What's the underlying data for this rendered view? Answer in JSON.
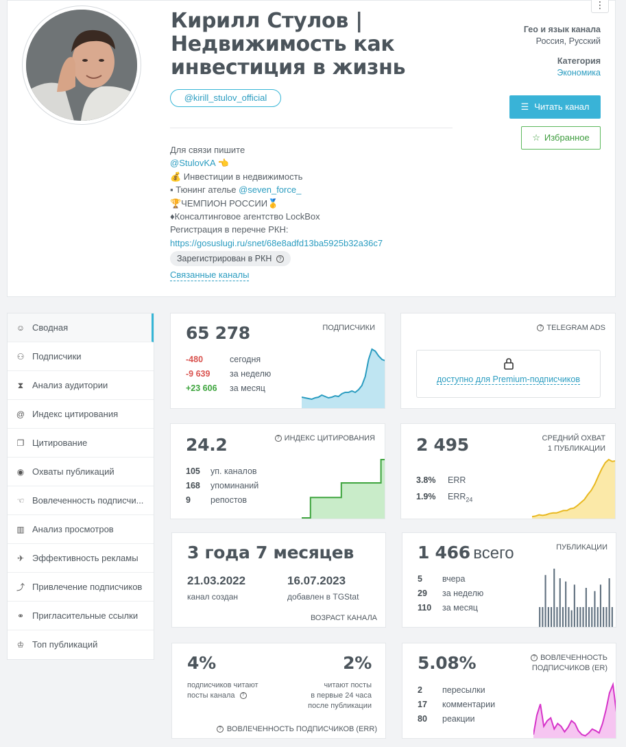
{
  "channel": {
    "title_lines": [
      "Кирилл Стулов |",
      "Недвижимость как",
      "инвестиция в жизнь"
    ],
    "handle": "@kirill_stulov_official",
    "description": [
      "Для связи пишите",
      "@StulovKA 👈",
      "💰 Инвестиции в недвижимость",
      "▪ Тюнинг ателье ",
      "🏆ЧЕМПИОН РОССИИ🥇",
      "♦Консалтинговое агентство LockBox",
      "Регистрация в перечне РКН:",
      "https://gosuslugi.ru/snet/68e8adfd13ba5925b32a36c7"
    ],
    "tuning_link": "@seven_force_",
    "rkn_badge": "Зарегистрирован в РКН",
    "related_link": "Связанные каналы",
    "geo_label": "Гео и язык канала",
    "geo_value": "Россия, Русский",
    "category_label": "Категория",
    "category_value": "Экономика",
    "read_button": "Читать канал",
    "favorite_button": "Избранное",
    "more_icon": "⋮"
  },
  "menu": [
    {
      "icon": "☺",
      "label": "Сводная",
      "active": true
    },
    {
      "icon": "⚇",
      "label": "Подписчики"
    },
    {
      "icon": "⧗",
      "label": "Анализ аудитории"
    },
    {
      "icon": "@",
      "label": "Индекс цитирования"
    },
    {
      "icon": "❐",
      "label": "Цитирование"
    },
    {
      "icon": "◉",
      "label": "Охваты публикаций"
    },
    {
      "icon": "☜",
      "label": "Вовлеченность подписчи..."
    },
    {
      "icon": "▥",
      "label": "Анализ просмотров"
    },
    {
      "icon": "✈",
      "label": "Эффективность рекламы"
    },
    {
      "icon": "⤴",
      "label": "Привлечение подписчиков"
    },
    {
      "icon": "⚭",
      "label": "Пригласительные ссылки"
    },
    {
      "icon": "♔",
      "label": "Топ публикаций"
    }
  ],
  "subscribers": {
    "value": "65 278",
    "label": "ПОДПИСЧИКИ",
    "rows": [
      {
        "v": "-480",
        "t": "сегодня"
      },
      {
        "v": "-9 639",
        "t": "за неделю"
      },
      {
        "v": "+23 606",
        "t": "за месяц"
      }
    ]
  },
  "ads": {
    "label": "TELEGRAM ADS",
    "locked_text": "доступно для Premium-подписчиков"
  },
  "citation": {
    "value": "24.2",
    "label": "ИНДЕКС ЦИТИРОВАНИЯ",
    "rows": [
      {
        "v": "105",
        "t": "уп. каналов"
      },
      {
        "v": "168",
        "t": "упоминаний"
      },
      {
        "v": "9",
        "t": "репостов"
      }
    ]
  },
  "reach": {
    "value": "2 495",
    "label_1": "СРЕДНИЙ ОХВАТ",
    "label_2": "1 ПУБЛИКАЦИИ",
    "rows": [
      {
        "v": "3.8%",
        "t": "ERR"
      },
      {
        "v": "1.9%",
        "t": "ERR",
        "sub": "24"
      }
    ]
  },
  "age": {
    "value": "3 года 7 месяцев",
    "created_date": "21.03.2022",
    "created_label": "канал создан",
    "added_date": "16.07.2023",
    "added_label": "добавлен в TGStat",
    "label": "ВОЗРАСТ КАНАЛА"
  },
  "posts": {
    "value": "1 466",
    "value_suffix": "всего",
    "label": "ПУБЛИКАЦИИ",
    "rows": [
      {
        "v": "5",
        "t": "вчера"
      },
      {
        "v": "29",
        "t": "за неделю"
      },
      {
        "v": "110",
        "t": "за месяц"
      }
    ]
  },
  "err": {
    "left_value": "4%",
    "left_text_1": "подписчиков читают",
    "left_text_2": "посты канала",
    "right_value": "2%",
    "right_text_1": "читают посты",
    "right_text_2": "в первые 24 часа",
    "right_text_3": "после публикации",
    "label": "ВОВЛЕЧЕННОСТЬ ПОДПИСЧИКОВ (ERR)"
  },
  "er": {
    "value": "5.08%",
    "label_1": "ВОВЛЕЧЕННОСТЬ",
    "label_2": "ПОДПИСЧИКОВ (ER)",
    "rows": [
      {
        "v": "2",
        "t": "пересылки"
      },
      {
        "v": "17",
        "t": "комментарии"
      },
      {
        "v": "80",
        "t": "реакции"
      }
    ]
  },
  "sparklines": {
    "subscribers": [
      15,
      14,
      13,
      12,
      14,
      15,
      18,
      16,
      14,
      15,
      17,
      16,
      20,
      22,
      22,
      24,
      22,
      26,
      32,
      45,
      70,
      85,
      82,
      75,
      70,
      68
    ],
    "citation": [
      0,
      0,
      35,
      35,
      35,
      35,
      35,
      35,
      35,
      60,
      60,
      60,
      60,
      60,
      60,
      60,
      60,
      60,
      100,
      100
    ],
    "reach": [
      2,
      3,
      5,
      4,
      5,
      7,
      8,
      8,
      10,
      12,
      12,
      15,
      16,
      20,
      25,
      30,
      38,
      45,
      55,
      68,
      80,
      90,
      95,
      92,
      93
    ],
    "posts": [
      30,
      30,
      80,
      30,
      30,
      90,
      30,
      75,
      30,
      70,
      30,
      25,
      65,
      30,
      30,
      30,
      60,
      30,
      30,
      55,
      30,
      65,
      30,
      30,
      75,
      30
    ],
    "er": [
      5,
      40,
      60,
      20,
      30,
      35,
      15,
      25,
      20,
      10,
      18,
      30,
      25,
      12,
      5,
      3,
      8,
      15,
      12,
      8,
      25,
      50,
      80,
      95,
      45
    ]
  },
  "colors": {
    "accent": "#35b5d6",
    "sub_line": "#2a9cc0",
    "sub_fill": "#bfe5f2",
    "cit_line": "#3da43d",
    "cit_fill": "#c9ecc9",
    "reach_line": "#e8b820",
    "reach_fill": "#fbe9a8",
    "posts_bar": "#5f6f7e",
    "er_line": "#d633c9",
    "er_fill": "#f6c5f1"
  }
}
